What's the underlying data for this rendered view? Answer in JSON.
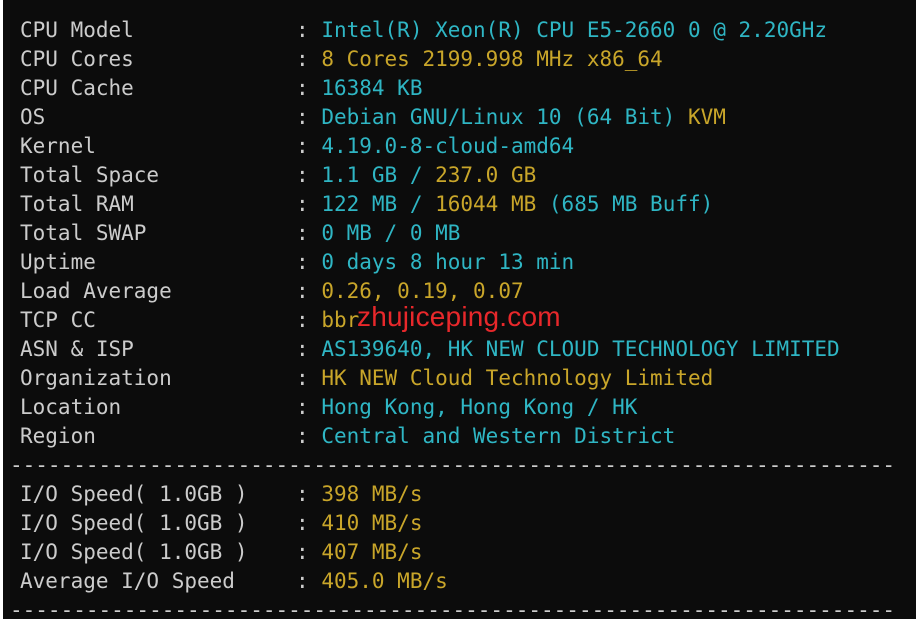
{
  "colors": {
    "background": "#0c0c0c",
    "label": "#cccccc",
    "cyan": "#2fb6c4",
    "yellow": "#c9a62a",
    "watermark": "#e8282b"
  },
  "rows": [
    {
      "label": "CPU Model",
      "colon": ":",
      "parts": [
        {
          "text": "Intel(R) Xeon(R) CPU E5-2660 0 @ 2.20GHz",
          "color": "cyan"
        }
      ]
    },
    {
      "label": "CPU Cores",
      "colon": ":",
      "parts": [
        {
          "text": "8 Cores 2199.998 MHz x86_64",
          "color": "yellow"
        }
      ]
    },
    {
      "label": "CPU Cache",
      "colon": ":",
      "parts": [
        {
          "text": "16384 KB",
          "color": "cyan"
        }
      ]
    },
    {
      "label": "OS",
      "colon": ":",
      "parts": [
        {
          "text": "Debian GNU/Linux 10 (64 Bit) ",
          "color": "cyan"
        },
        {
          "text": "KVM",
          "color": "yellow"
        }
      ]
    },
    {
      "label": "Kernel",
      "colon": ":",
      "parts": [
        {
          "text": "4.19.0-8-cloud-amd64",
          "color": "cyan"
        }
      ]
    },
    {
      "label": "Total Space",
      "colon": ":",
      "parts": [
        {
          "text": "1.1 GB / ",
          "color": "cyan"
        },
        {
          "text": "237.0 GB",
          "color": "yellow"
        }
      ]
    },
    {
      "label": "Total RAM",
      "colon": ":",
      "parts": [
        {
          "text": "122 MB / ",
          "color": "cyan"
        },
        {
          "text": "16044 MB",
          "color": "yellow"
        },
        {
          "text": " (685 MB Buff)",
          "color": "cyan"
        }
      ]
    },
    {
      "label": "Total SWAP",
      "colon": ":",
      "parts": [
        {
          "text": "0 MB / 0 MB",
          "color": "cyan"
        }
      ]
    },
    {
      "label": "Uptime",
      "colon": ":",
      "parts": [
        {
          "text": "0 days 8 hour 13 min",
          "color": "cyan"
        }
      ]
    },
    {
      "label": "Load Average",
      "colon": ":",
      "parts": [
        {
          "text": "0.26, 0.19, 0.07",
          "color": "yellow"
        }
      ]
    },
    {
      "label": "TCP CC",
      "colon": ":",
      "parts": [
        {
          "text": "bbr",
          "color": "yellow"
        }
      ]
    },
    {
      "label": "ASN & ISP",
      "colon": ":",
      "parts": [
        {
          "text": "AS139640, HK NEW CLOUD TECHNOLOGY LIMITED",
          "color": "cyan"
        }
      ]
    },
    {
      "label": "Organization",
      "colon": ":",
      "parts": [
        {
          "text": "HK NEW Cloud Technology Limited",
          "color": "yellow"
        }
      ]
    },
    {
      "label": "Location",
      "colon": ":",
      "parts": [
        {
          "text": "Hong Kong, Hong Kong / HK",
          "color": "cyan"
        }
      ]
    },
    {
      "label": "Region",
      "colon": ":",
      "parts": [
        {
          "text": "Central and Western District",
          "color": "cyan"
        }
      ]
    }
  ],
  "separator": "----------------------------------------------------------------------",
  "io_rows": [
    {
      "label": "I/O Speed( 1.0GB )",
      "colon": ":",
      "parts": [
        {
          "text": "398 MB/s",
          "color": "yellow"
        }
      ]
    },
    {
      "label": "I/O Speed( 1.0GB )",
      "colon": ":",
      "parts": [
        {
          "text": "410 MB/s",
          "color": "yellow"
        }
      ]
    },
    {
      "label": "I/O Speed( 1.0GB )",
      "colon": ":",
      "parts": [
        {
          "text": "407 MB/s",
          "color": "yellow"
        }
      ]
    },
    {
      "label": "Average I/O Speed",
      "colon": ":",
      "parts": [
        {
          "text": "405.0 MB/s",
          "color": "yellow"
        }
      ]
    }
  ],
  "watermark": "zhujiceping.com"
}
